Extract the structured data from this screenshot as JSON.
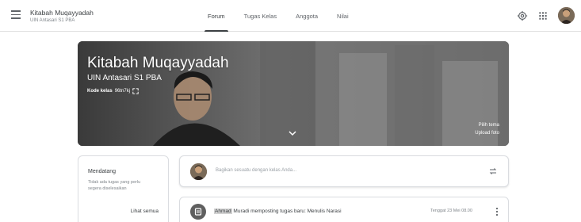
{
  "header": {
    "class_title": "Kitabah Muqayyadah",
    "class_subtitle": "UIN Antasari S1 PBA",
    "tabs": [
      {
        "label": "Forum",
        "active": true
      },
      {
        "label": "Tugas Kelas",
        "active": false
      },
      {
        "label": "Anggota",
        "active": false
      },
      {
        "label": "Nilai",
        "active": false
      }
    ],
    "icons": [
      "menu-icon",
      "gear-icon",
      "apps-icon",
      "avatar"
    ]
  },
  "banner": {
    "title": "Kitabah Muqayyadah",
    "subtitle": "UIN Antasari S1 PBA",
    "code_label": "Kode kelas",
    "code_value": "96tn7kj",
    "select_theme": "Pilih tema",
    "upload_photo": "Upload foto"
  },
  "upcoming": {
    "title": "Mendatang",
    "text": "Tidak ada tugas yang perlu segera diselesaikan",
    "view_all": "Lihat semua"
  },
  "share": {
    "placeholder": "Bagikan sesuatu dengan kelas Anda..."
  },
  "post": {
    "author": "Ahmad",
    "text": " Muradi memposting tugas baru: Menulis Narasi",
    "date": "Tenggat 23 Mei 08.00"
  },
  "colors": {
    "accent": "#3c4043",
    "banner_bg": "#4a4a4a"
  }
}
